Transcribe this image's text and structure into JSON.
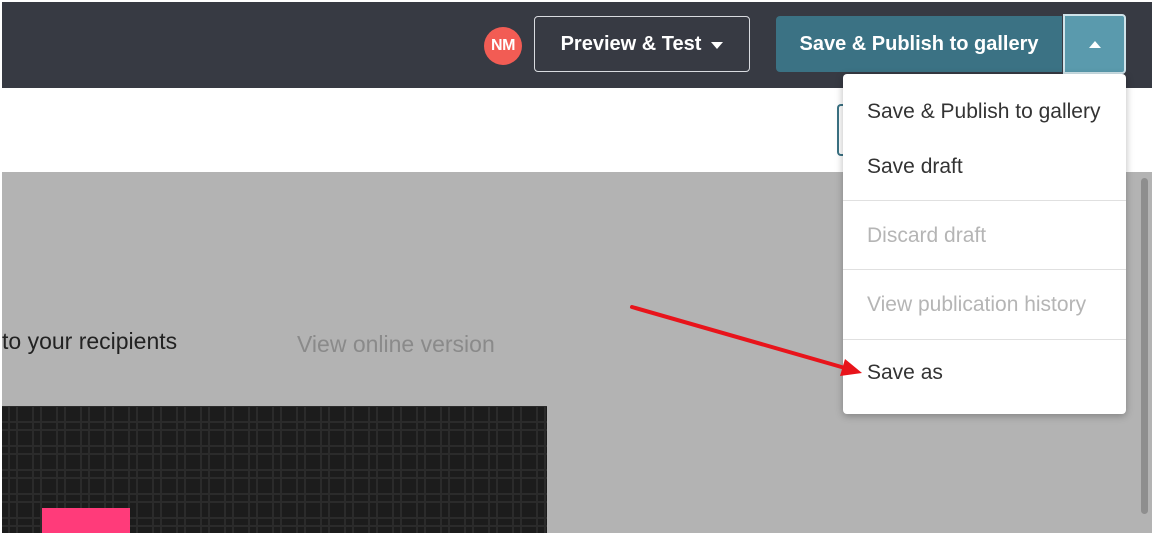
{
  "header": {
    "avatar_initials": "NM",
    "preview_label": "Preview & Test",
    "publish_label": "Save & Publish to gallery"
  },
  "content": {
    "recipients_text": "to your recipients",
    "view_online_label": "View online version"
  },
  "menu": {
    "items": [
      {
        "label": "Save & Publish to gallery",
        "enabled": true
      },
      {
        "label": "Save draft",
        "enabled": true
      },
      {
        "label": "Discard draft",
        "enabled": false
      },
      {
        "label": "View publication history",
        "enabled": false
      },
      {
        "label": "Save as",
        "enabled": true
      }
    ]
  },
  "colors": {
    "topbar": "#373a43",
    "publish_button": "#3b7284",
    "avatar": "#f25c54",
    "annotation_arrow": "#e8141b"
  },
  "icons": {
    "preview_caret": "chevron-down-icon",
    "menu_toggle_caret": "chevron-up-icon",
    "annotation": "red-arrow-icon"
  }
}
